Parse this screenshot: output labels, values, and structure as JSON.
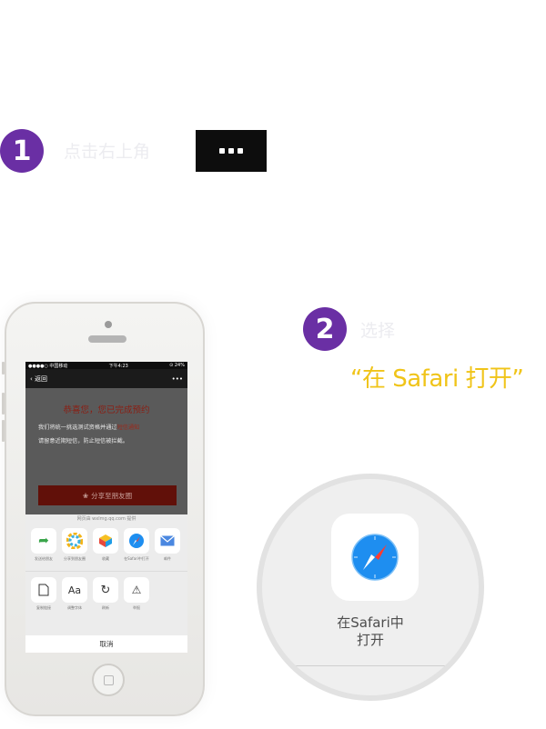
{
  "step1": {
    "number": "1",
    "caption": "点击右上角"
  },
  "step2": {
    "number": "2",
    "caption": "选择",
    "option_quote": "“在 Safari 打开”"
  },
  "phone": {
    "status": {
      "carrier": "●●●●○ 中国移动",
      "time": "下午4:23",
      "battery": "⊙ 24%"
    },
    "nav": {
      "back": "返回",
      "more": "•••"
    },
    "page": {
      "title": "恭喜您，您已完成预约",
      "para1_prefix": "我们将统一挑选测试资格并通过",
      "para1_highlight": "短信通知",
      "para2": "请留意近期短信，防止短信被拦截。",
      "share_button": "分享至朋友圈"
    },
    "sheet": {
      "source": "网页由 wxlmg.qq.com 提供",
      "row1": [
        {
          "icon": "send-to-friend-icon",
          "label": "发送给朋友"
        },
        {
          "icon": "moments-icon",
          "label": "分享到朋友圈"
        },
        {
          "icon": "favorites-icon",
          "label": "收藏"
        },
        {
          "icon": "safari-icon",
          "label": "在Safari中打开"
        },
        {
          "icon": "mail-icon",
          "label": "邮件"
        }
      ],
      "row2": [
        {
          "icon": "copy-link-icon",
          "label": "复制链接"
        },
        {
          "icon": "font-size-icon",
          "label": "调整字体"
        },
        {
          "icon": "refresh-icon",
          "label": "刷新"
        },
        {
          "icon": "report-icon",
          "label": "举报"
        }
      ],
      "cancel": "取消"
    }
  },
  "zoom": {
    "label_line1": "在Safari中",
    "label_line2": "打开"
  },
  "colors": {
    "step_badge": "#6a2fa4",
    "quote": "#f0c419",
    "safari_blue": "#1e8ef0"
  }
}
